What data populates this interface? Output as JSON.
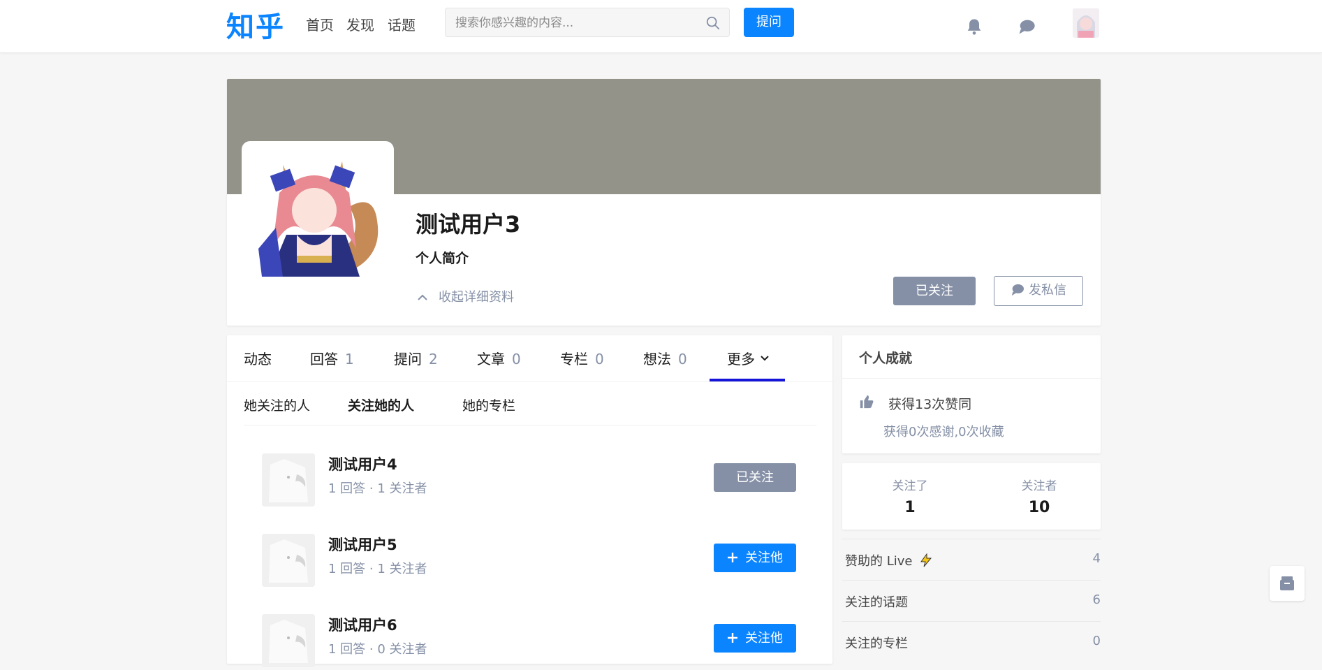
{
  "header": {
    "logo": "知乎",
    "nav": [
      "首页",
      "发现",
      "话题"
    ],
    "search_placeholder": "搜索你感兴趣的内容...",
    "ask_label": "提问"
  },
  "profile": {
    "name": "测试用户3",
    "bio_label": "个人简介",
    "collapse_label": "收起详细资料",
    "followed_label": "已关注",
    "message_label": "发私信"
  },
  "tabs": [
    {
      "label": "动态",
      "count": ""
    },
    {
      "label": "回答",
      "count": "1"
    },
    {
      "label": "提问",
      "count": "2"
    },
    {
      "label": "文章",
      "count": "0"
    },
    {
      "label": "专栏",
      "count": "0"
    },
    {
      "label": "想法",
      "count": "0"
    },
    {
      "label": "更多",
      "count": ""
    }
  ],
  "subtabs": [
    "她关注的人",
    "关注她的人",
    "她的专栏"
  ],
  "users": [
    {
      "name": "测试用户4",
      "meta": "1 回答 · 1 关注者",
      "button": "已关注"
    },
    {
      "name": "测试用户5",
      "meta": "1 回答 · 1 关注者",
      "button": "关注他"
    },
    {
      "name": "测试用户6",
      "meta": "1 回答 · 0 关注者",
      "button": "关注他"
    }
  ],
  "achievements": {
    "title": "个人成就",
    "likes": "获得13次赞同",
    "thanks": "获得0次感谢,0次收藏"
  },
  "follow_stats": {
    "following_label": "关注了",
    "following": "1",
    "followers_label": "关注者",
    "followers": "10"
  },
  "side_list": [
    {
      "label": "赞助的 Live",
      "value": "4"
    },
    {
      "label": "关注的话题",
      "value": "6"
    },
    {
      "label": "关注的专栏",
      "value": "0"
    }
  ],
  "colors": {
    "brand": "#0a84ff",
    "muted": "#8590a6",
    "cover": "#93938a",
    "tab_underline": "#1514d8"
  }
}
